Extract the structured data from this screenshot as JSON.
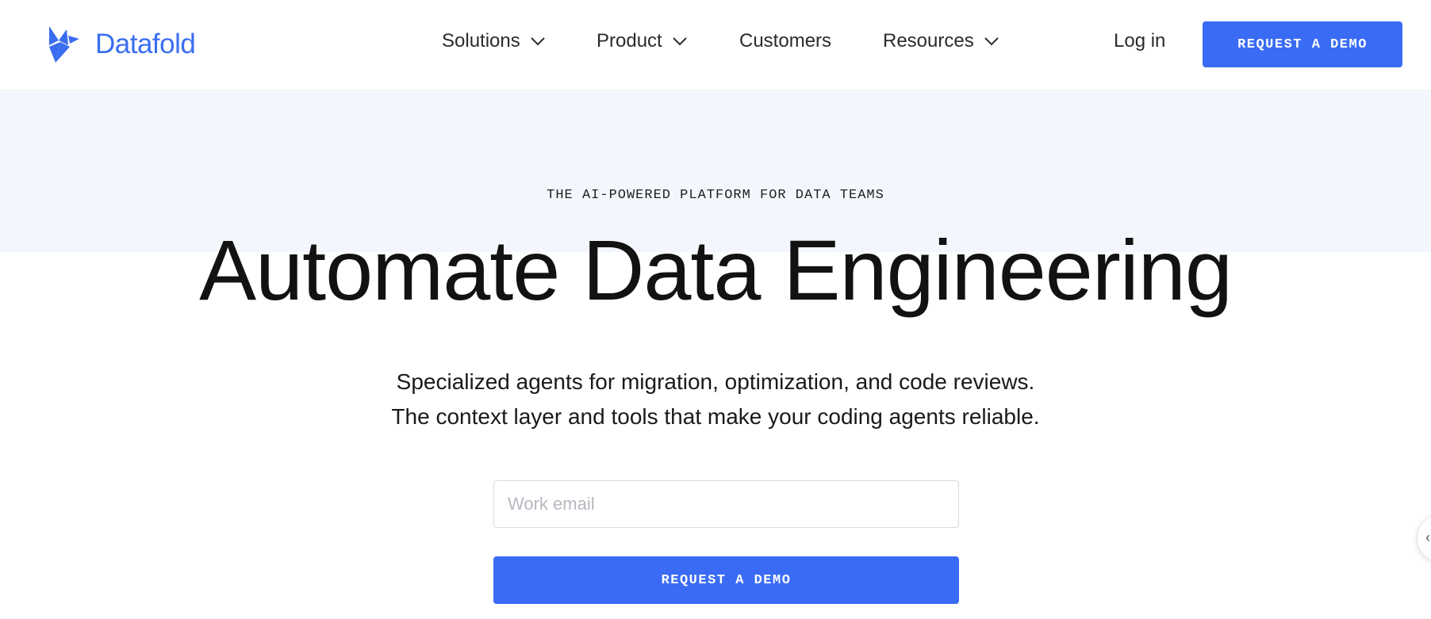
{
  "brand": {
    "name": "Datafold",
    "logo_icon": "datafold-origami-bird-icon",
    "accent_color": "#3a6bf5"
  },
  "nav": {
    "items": [
      {
        "label": "Solutions",
        "has_dropdown": true
      },
      {
        "label": "Product",
        "has_dropdown": true
      },
      {
        "label": "Customers",
        "has_dropdown": false
      },
      {
        "label": "Resources",
        "has_dropdown": true
      }
    ],
    "login_label": "Log in",
    "cta_label": "REQUEST A DEMO"
  },
  "hero": {
    "eyebrow": "THE AI-POWERED PLATFORM FOR DATA TEAMS",
    "title": "Automate Data Engineering",
    "subtitle_line1": "Specialized agents for migration, optimization, and code reviews.",
    "subtitle_line2": "The context layer and tools that make your coding agents reliable.",
    "email_placeholder": "Work email",
    "email_value": "",
    "cta_label": "REQUEST A DEMO"
  },
  "colors": {
    "band_background": "#f3f6fd",
    "button": "#3a6bf5",
    "text": "#1a1a1a"
  }
}
